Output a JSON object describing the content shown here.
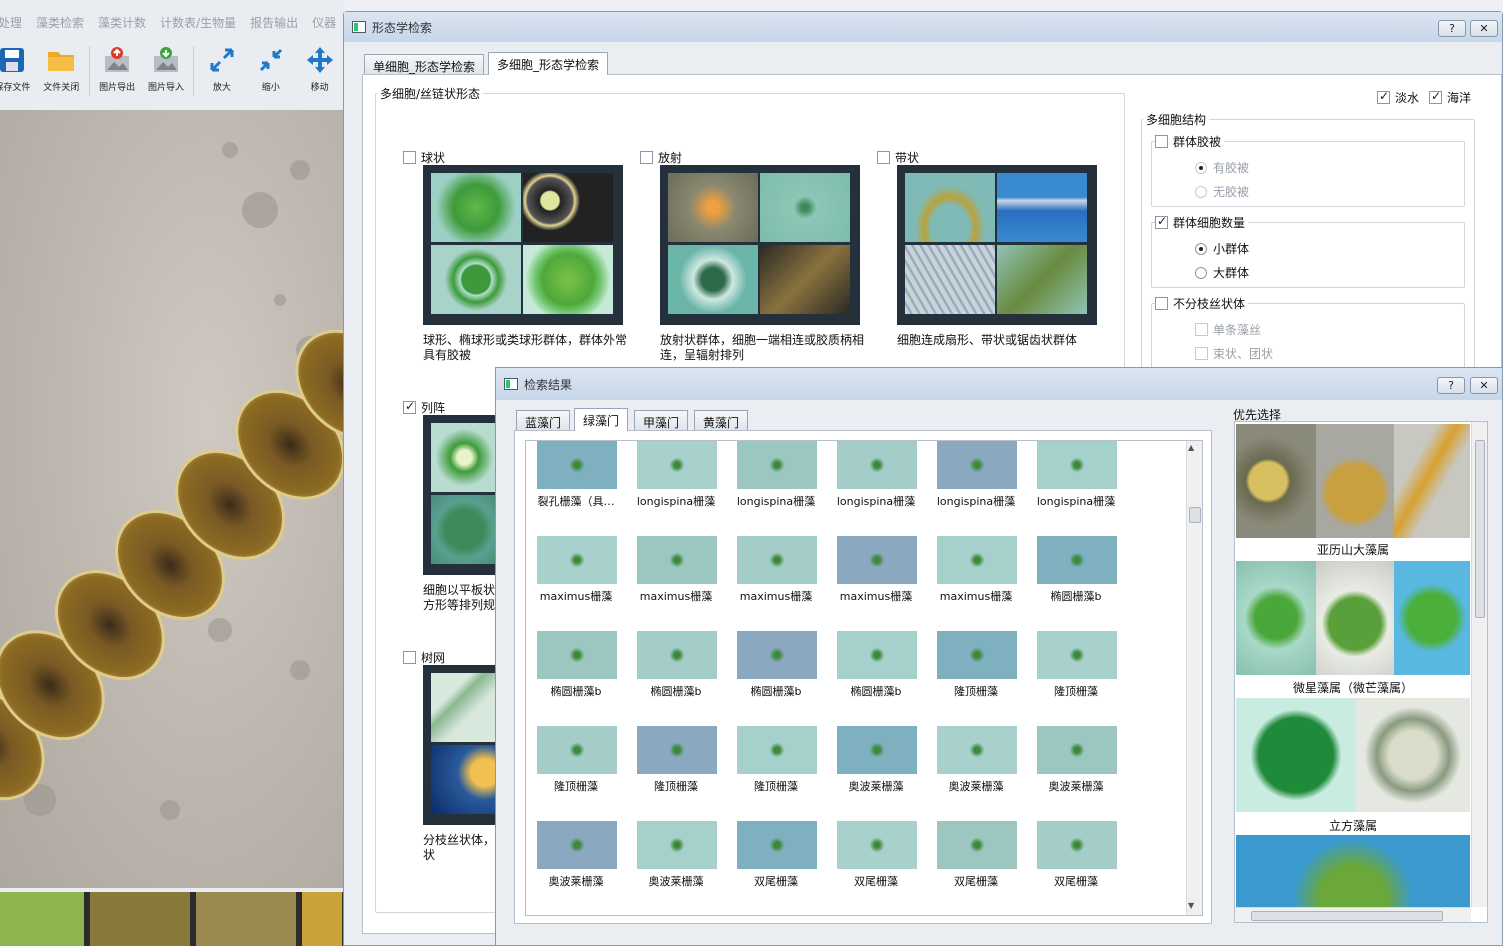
{
  "bg_app": {
    "menu": [
      "处理",
      "藻类检索",
      "藻类计数",
      "计数表/生物量",
      "报告输出",
      "仪器"
    ],
    "toolbar": [
      {
        "label": "保存文件",
        "icon": "save-icon"
      },
      {
        "label": "文件关闭",
        "icon": "folder-icon"
      },
      {
        "label": "图片导出",
        "icon": "image-export-icon"
      },
      {
        "label": "图片导入",
        "icon": "image-import-icon"
      },
      {
        "label": "放大",
        "icon": "zoom-in-icon"
      },
      {
        "label": "缩小",
        "icon": "zoom-out-icon"
      },
      {
        "label": "移动",
        "icon": "move-icon"
      }
    ]
  },
  "win1": {
    "title": "形态学检索",
    "help": "?",
    "close": "✕",
    "tabs": [
      "单细胞_形态学检索",
      "多细胞_形态学检索"
    ],
    "group_title": "多细胞/丝链状形态",
    "shapes": [
      {
        "label": "球状",
        "checked": false,
        "desc": "球形、椭球形或类球形群体，群体外常具有胶被"
      },
      {
        "label": "放射",
        "checked": false,
        "desc": "放射状群体，细胞一端相连或胶质柄相连，呈辐射排列"
      },
      {
        "label": "带状",
        "checked": false,
        "desc": "细胞连成扇形、带状或锯齿状群体"
      },
      {
        "label": "列阵",
        "checked": true,
        "desc": "细胞以平板状方形等排列规"
      },
      {
        "label": "树网",
        "checked": false,
        "desc": "分枝丝状体，状"
      }
    ],
    "freshwater": "淡水",
    "marine": "海洋",
    "struct_title": "多细胞结构",
    "colony_sheath": "群体胶被",
    "has_sheath": "有胶被",
    "no_sheath": "无胶被",
    "colony_count": "群体细胞数量",
    "small_colony": "小群体",
    "large_colony": "大群体",
    "unbranched": "不分枝丝状体",
    "single_filament": "单条藻丝",
    "bundle": "束状、团状"
  },
  "win2": {
    "title": "检索结果",
    "help": "?",
    "close": "✕",
    "tabs": [
      "蓝藻门",
      "绿藻门",
      "甲藻门",
      "黄藻门"
    ],
    "results": [
      [
        "裂孔栅藻（具…",
        "longispina栅藻",
        "longispina栅藻",
        "longispina栅藻",
        "longispina栅藻",
        "longispina栅藻"
      ],
      [
        "maximus栅藻",
        "maximus栅藻",
        "maximus栅藻",
        "maximus栅藻",
        "maximus栅藻",
        "椭圆栅藻b"
      ],
      [
        "椭圆栅藻b",
        "椭圆栅藻b",
        "椭圆栅藻b",
        "椭圆栅藻b",
        "隆顶栅藻",
        "隆顶栅藻"
      ],
      [
        "隆顶栅藻",
        "隆顶栅藻",
        "隆顶栅藻",
        "奥波莱栅藻",
        "奥波莱栅藻",
        "奥波莱栅藻"
      ],
      [
        "奥波莱栅藻",
        "奥波莱栅藻",
        "双尾栅藻",
        "双尾栅藻",
        "双尾栅藻",
        "双尾栅藻"
      ]
    ],
    "priority_title": "优先选择",
    "priority": [
      "亚历山大藻属",
      "微星藻属（微芒藻属）",
      "立方藻属"
    ]
  }
}
